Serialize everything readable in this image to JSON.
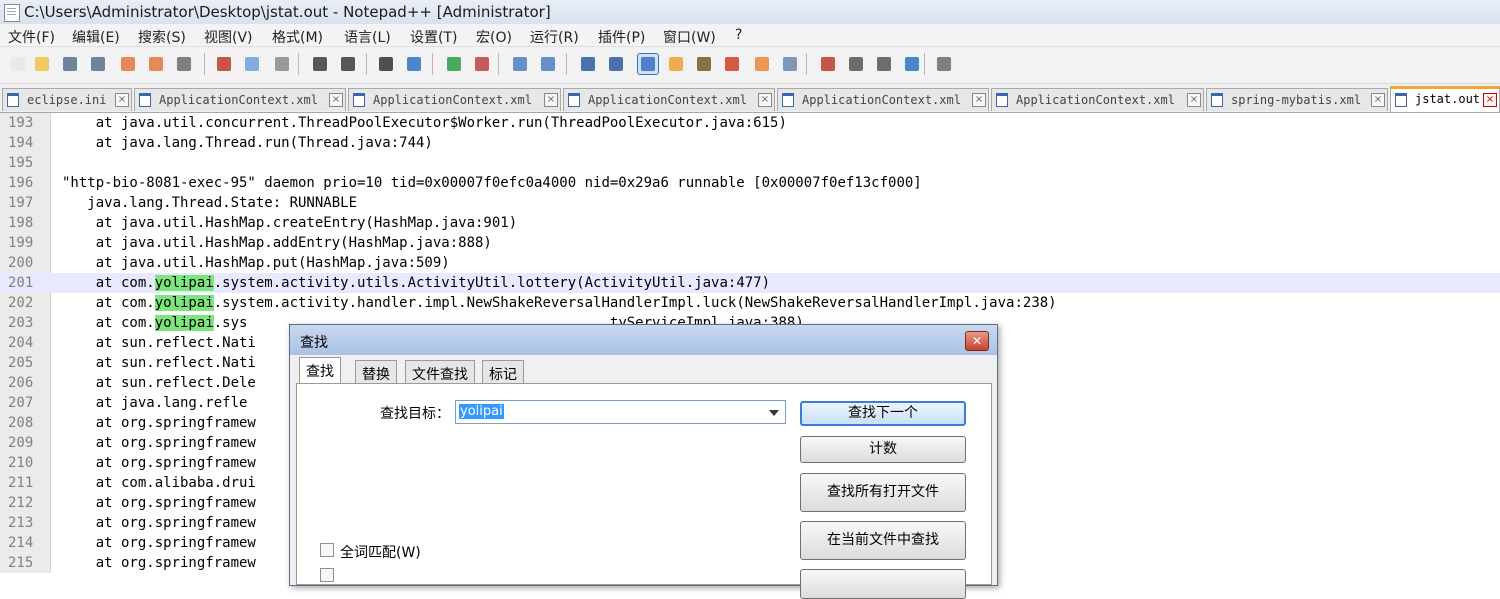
{
  "window": {
    "title": "C:\\Users\\Administrator\\Desktop\\jstat.out - Notepad++ [Administrator]"
  },
  "menu": [
    "文件(F)",
    "编辑(E)",
    "搜索(S)",
    "视图(V)",
    "格式(M)",
    "语言(L)",
    "设置(T)",
    "宏(O)",
    "运行(R)",
    "插件(P)",
    "窗口(W)",
    "?"
  ],
  "toolbar_icons": [
    "new-file-icon",
    "open-file-icon",
    "save-icon",
    "save-all-icon",
    "close-icon",
    "close-all-icon",
    "print-icon",
    "cut-icon",
    "copy-icon",
    "paste-icon",
    "undo-icon",
    "redo-icon",
    "find-icon",
    "replace-icon",
    "zoom-in-icon",
    "zoom-out-icon",
    "sync-vertical-icon",
    "sync-horizontal-icon",
    "word-wrap-icon",
    "show-all-chars-icon",
    "indent-guide-icon",
    "doc-map-icon",
    "function-list-icon",
    "udl-icon",
    "folder-icon",
    "monitor-icon",
    "record-macro-icon",
    "stop-macro-icon",
    "play-macro-icon",
    "run-macro-multiple-icon",
    "save-macro-icon"
  ],
  "colors": {
    "active_tab_accent": "#f3a53a",
    "search_highlight": "#7ce67c",
    "current_line": "#e8e8ff"
  },
  "tabs": [
    {
      "label": "eclipse.ini",
      "active": false
    },
    {
      "label": "ApplicationContext.xml",
      "active": false
    },
    {
      "label": "ApplicationContext.xml",
      "active": false
    },
    {
      "label": "ApplicationContext.xml",
      "active": false
    },
    {
      "label": "ApplicationContext.xml",
      "active": false
    },
    {
      "label": "ApplicationContext.xml",
      "active": false
    },
    {
      "label": "spring-mybatis.xml",
      "active": false
    },
    {
      "label": "jstat.out",
      "active": true
    }
  ],
  "editor": {
    "current_line": 201,
    "highlight_term": "yolipai",
    "lines": [
      {
        "n": "193",
        "text": "    at java.util.concurrent.ThreadPoolExecutor$Worker.run(ThreadPoolExecutor.java:615)"
      },
      {
        "n": "194",
        "text": "    at java.lang.Thread.run(Thread.java:744)"
      },
      {
        "n": "195",
        "text": ""
      },
      {
        "n": "196",
        "text": "\"http-bio-8081-exec-95\" daemon prio=10 tid=0x00007f0efc0a4000 nid=0x29a6 runnable [0x00007f0ef13cf000]"
      },
      {
        "n": "197",
        "text": "   java.lang.Thread.State: RUNNABLE"
      },
      {
        "n": "198",
        "text": "    at java.util.HashMap.createEntry(HashMap.java:901)"
      },
      {
        "n": "199",
        "text": "    at java.util.HashMap.addEntry(HashMap.java:888)"
      },
      {
        "n": "200",
        "text": "    at java.util.HashMap.put(HashMap.java:509)"
      },
      {
        "n": "201",
        "text": "    at com.yolipai.system.activity.utils.ActivityUtil.lottery(ActivityUtil.java:477)"
      },
      {
        "n": "202",
        "text": "    at com.yolipai.system.activity.handler.impl.NewShakeReversalHandlerImpl.luck(NewShakeReversalHandlerImpl.java:238)"
      },
      {
        "n": "203",
        "text": "    at com.yolipai.sys                                           tyServiceImpl.java:388)"
      },
      {
        "n": "204",
        "text": "    at sun.reflect.Nati"
      },
      {
        "n": "205",
        "text": "    at sun.reflect.Nati"
      },
      {
        "n": "206",
        "text": "    at sun.reflect.Dele"
      },
      {
        "n": "207",
        "text": "    at java.lang.refle"
      },
      {
        "n": "208",
        "text": "    at org.springframew                                          317)"
      },
      {
        "n": "209",
        "text": "    at org.springframew                                          eMethodInvocation.java:183)"
      },
      {
        "n": "210",
        "text": "    at org.springframew                                          nvocation.java:150)"
      },
      {
        "n": "211",
        "text": "    at com.alibaba.drui                                          .java:73)"
      },
      {
        "n": "212",
        "text": "    at org.springframew                                          nvocation.java:172)"
      },
      {
        "n": "213",
        "text": "    at org.springframew                                          nterceptor.java:110)"
      },
      {
        "n": "214",
        "text": "    at org.springframew                                          nvocation.java:172)"
      },
      {
        "n": "215",
        "text": "    at org.springframew                                          nInterceptor.java:90)"
      }
    ]
  },
  "find_dialog": {
    "title": "查找",
    "close": "✕",
    "tabs": [
      "查找",
      "替换",
      "文件查找",
      "标记"
    ],
    "target_label": "查找目标：",
    "target_value": "yolipai",
    "buttons": [
      "查找下一个",
      "计数",
      "查找所有打开文件",
      "在当前文件中查找"
    ],
    "checkboxes": [
      {
        "label": "全词匹配(W)",
        "checked": false
      }
    ]
  }
}
